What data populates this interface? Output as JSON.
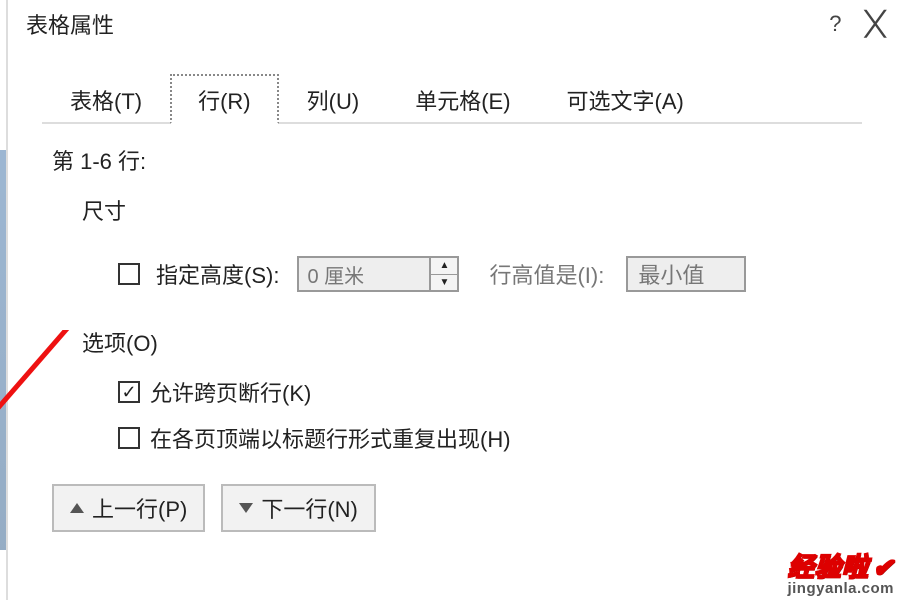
{
  "title": "表格属性",
  "help": "?",
  "tabs": {
    "table": "表格(T)",
    "row": "行(R)",
    "column": "列(U)",
    "cell": "单元格(E)",
    "alt": "可选文字(A)"
  },
  "row_info": "第 1-6 行:",
  "size_label": "尺寸",
  "specify_height": "指定高度(S):",
  "height_value": "0 厘米",
  "row_height_is": "行高值是(I):",
  "row_height_rule": "最小值",
  "options_label": "选项(O)",
  "allow_break": "允许跨页断行(K)",
  "repeat_header": "在各页顶端以标题行形式重复出现(H)",
  "prev_row": "上一行(P)",
  "next_row": "下一行(N)",
  "watermark_top": "经验啦",
  "watermark_bot": "jingyanla.com"
}
